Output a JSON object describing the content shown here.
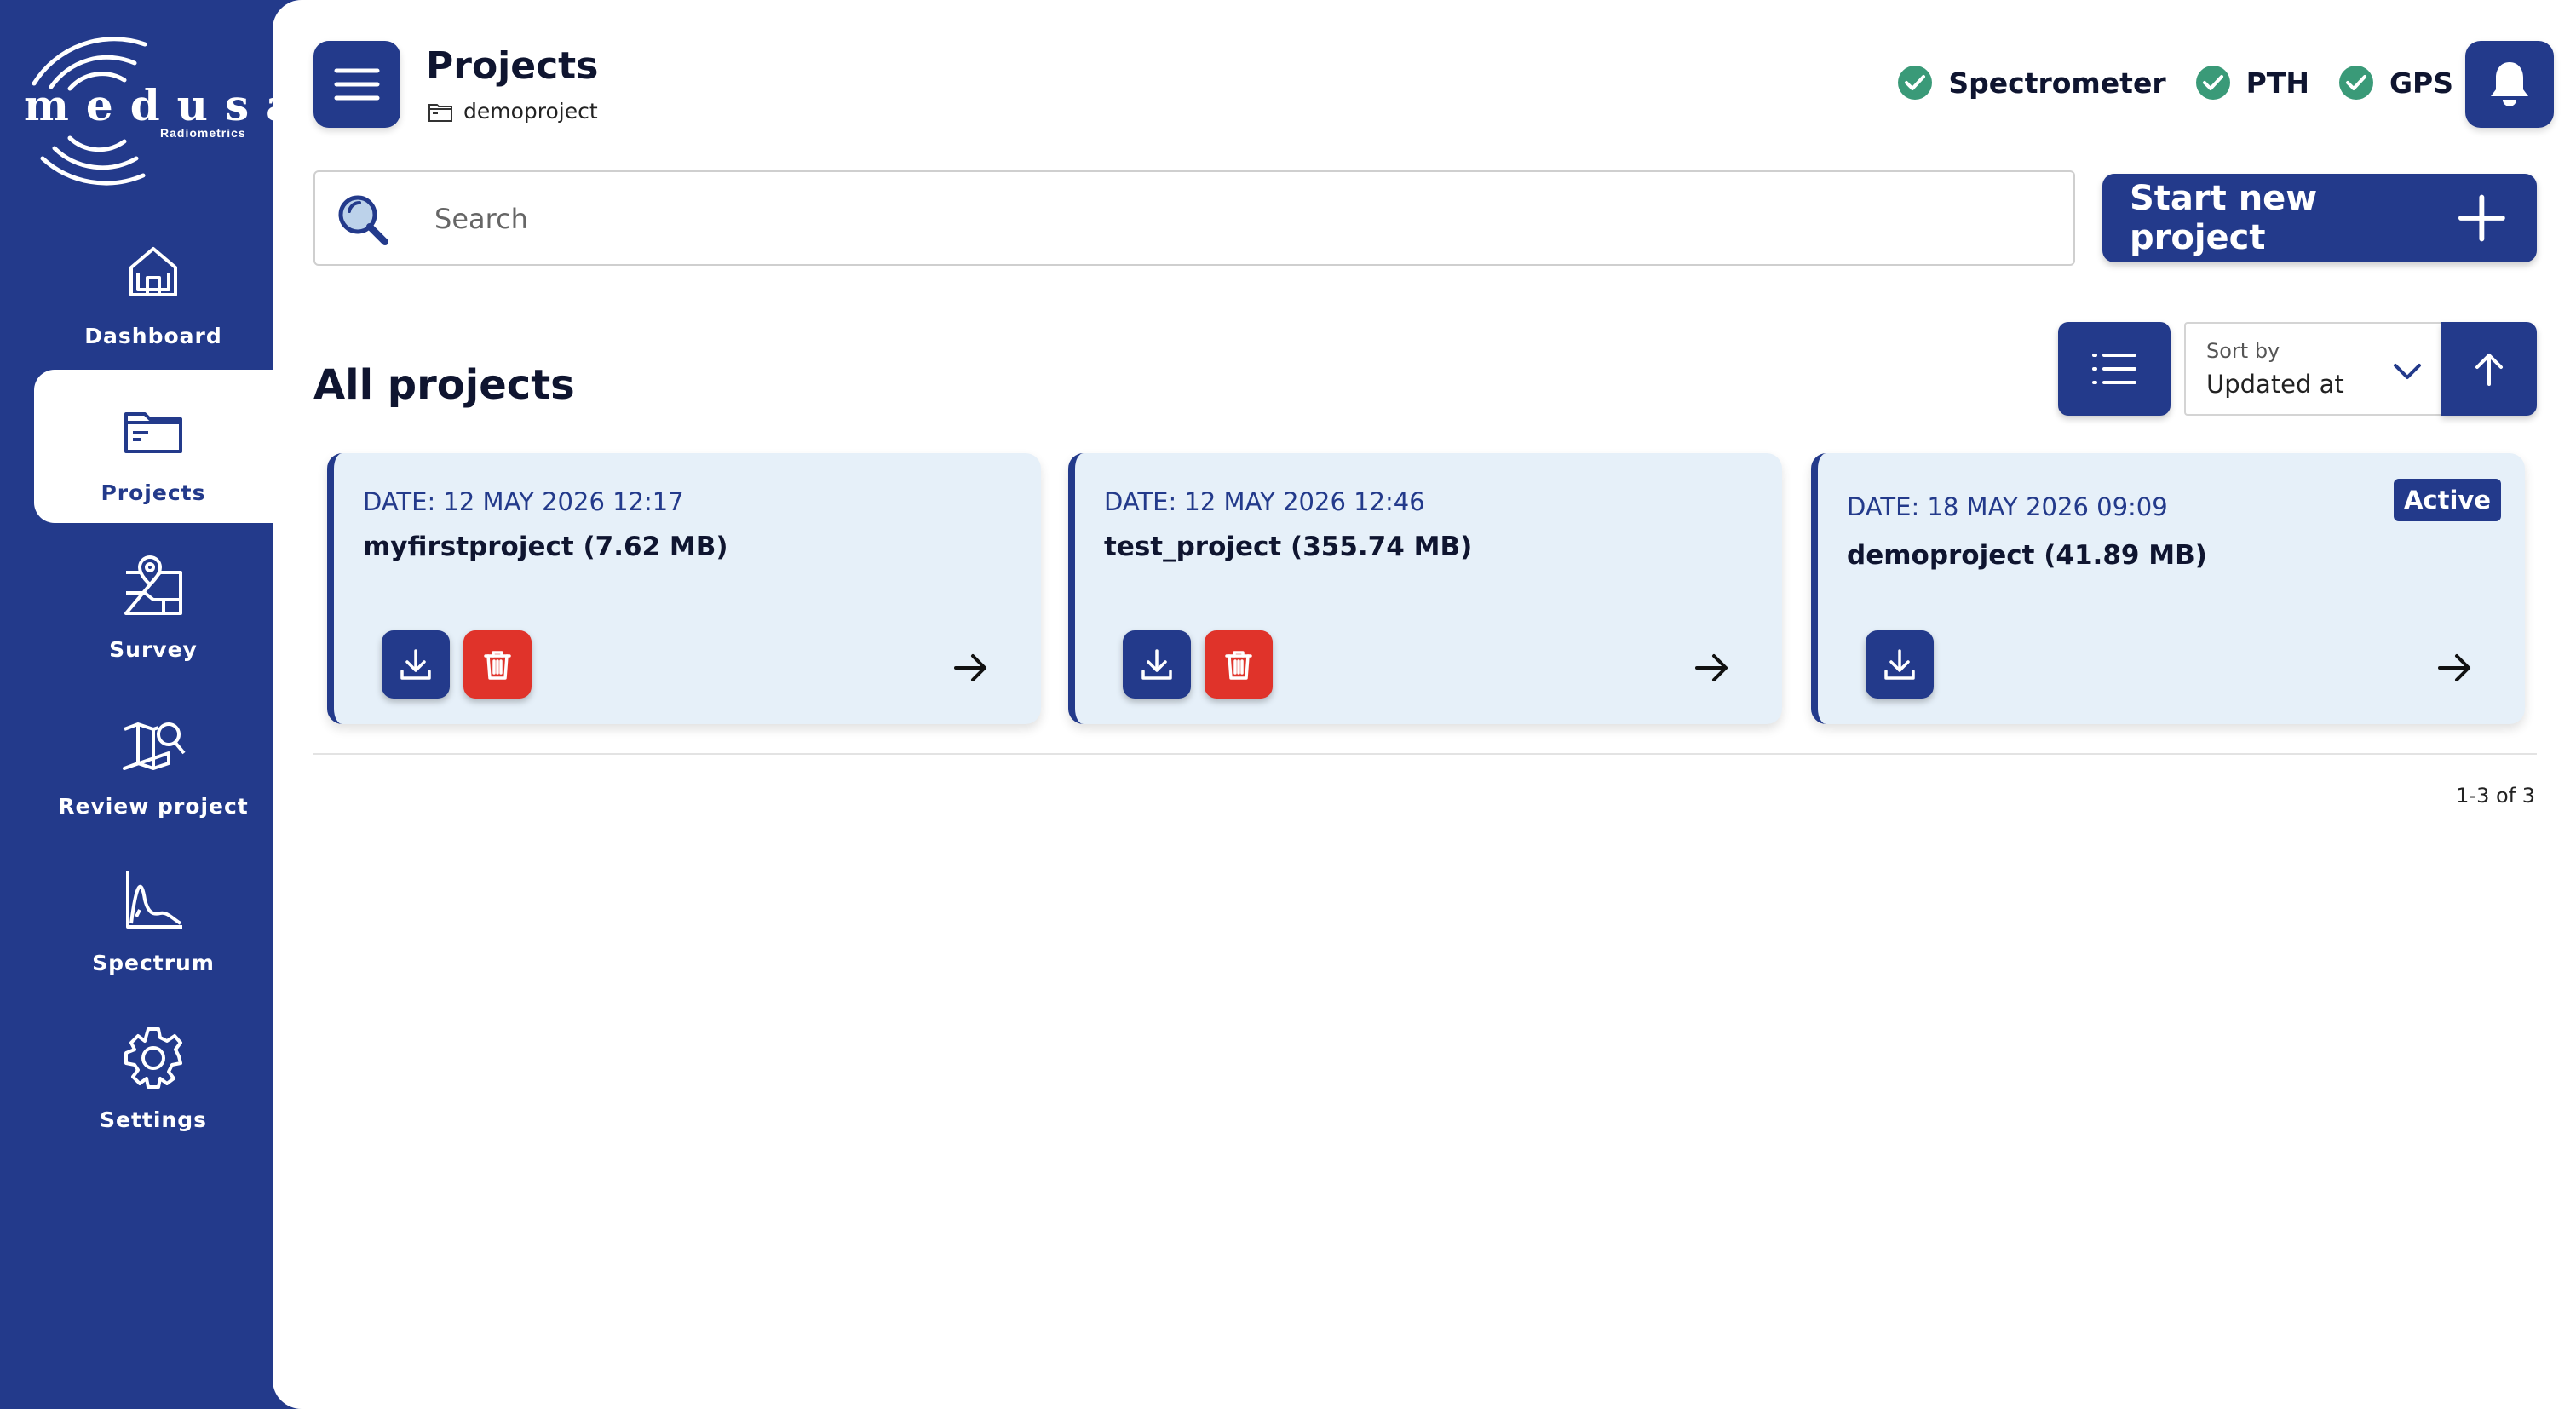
{
  "brand": {
    "name": "medusa",
    "sub": "Radiometrics"
  },
  "sidebar": {
    "items": [
      {
        "label": "Dashboard",
        "icon": "home-icon"
      },
      {
        "label": "Projects",
        "icon": "folder-icon"
      },
      {
        "label": "Survey",
        "icon": "map-pin-icon"
      },
      {
        "label": "Review project",
        "icon": "map-search-icon"
      },
      {
        "label": "Spectrum",
        "icon": "chart-spectrum-icon"
      },
      {
        "label": "Settings",
        "icon": "gear-icon"
      }
    ],
    "active_index": 1
  },
  "header": {
    "title": "Projects",
    "breadcrumb": "demoproject",
    "statuses": [
      {
        "label": "Spectrometer",
        "ok": true
      },
      {
        "label": "PTH",
        "ok": true
      },
      {
        "label": "GPS",
        "ok": true
      }
    ]
  },
  "search": {
    "placeholder": "Search",
    "value": ""
  },
  "new_project_label": "Start new project",
  "section_title": "All projects",
  "sort": {
    "label": "Sort by",
    "value": "Updated at",
    "direction": "ascending"
  },
  "projects": [
    {
      "date": "DATE: 12 MAY 2026 12:17",
      "name": "myfirstproject (7.62 MB)",
      "active": false,
      "deletable": true
    },
    {
      "date": "DATE: 12 MAY 2026 12:46",
      "name": "test_project (355.74 MB)",
      "active": false,
      "deletable": true
    },
    {
      "date": "DATE: 18 MAY 2026 09:09",
      "name": "demoproject (41.89 MB)",
      "active": true,
      "active_label": "Active",
      "deletable": false
    }
  ],
  "pagination": "1-3 of 3",
  "colors": {
    "primary": "#233a8b",
    "danger": "#e0332a",
    "ok": "#3a9a78",
    "card_bg": "#e6f0f9"
  }
}
